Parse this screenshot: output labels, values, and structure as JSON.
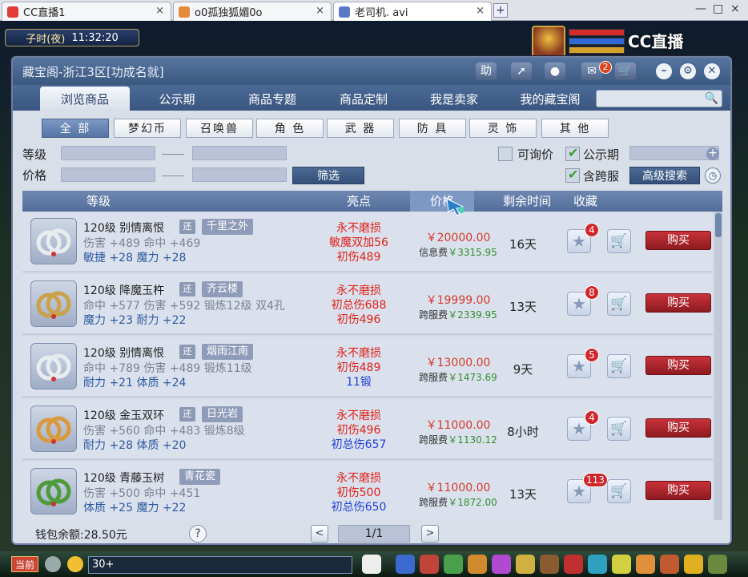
{
  "browser_tabs": [
    {
      "label": "CC直播1",
      "close": "×"
    },
    {
      "label": "o0孤独狐媚0o",
      "close": "×"
    },
    {
      "label": "老司机. avi",
      "close": "×"
    }
  ],
  "new_tab": "+",
  "window_controls": {
    "minimize": "—",
    "maximize": "□",
    "close": "×"
  },
  "game": {
    "clock_period": "子时(夜)",
    "clock_time": "11:32:20",
    "stream_logo": "CC直播",
    "bottom_current": "当前",
    "chat_input": "30+"
  },
  "panel": {
    "title": "藏宝阁-浙江3区[功成名就]",
    "help_label": "助",
    "message_count": "2",
    "nav_tabs": [
      "浏览商品",
      "公示期",
      "商品专题",
      "商品定制",
      "我是卖家",
      "我的藏宝阁"
    ],
    "categories": [
      "全 部",
      "梦幻币",
      "召唤兽",
      "角 色",
      "武 器",
      "防 具",
      "灵 饰",
      "其 他"
    ],
    "filter": {
      "level_label": "等级",
      "price_label": "价格",
      "filter_button": "筛选",
      "inquiry_label": "可询价",
      "public_label": "公示期",
      "cross_label": "含跨服",
      "advanced_button": "高级搜索"
    },
    "columns": {
      "level": "等级",
      "highlight": "亮点",
      "price": "价格",
      "remain": "剩余时间",
      "fav": "收藏"
    },
    "buy_label": "购买",
    "footer": {
      "wallet": "钱包余额:28.50元",
      "help": "?",
      "prev": "<",
      "page": "1/1",
      "next": ">"
    }
  },
  "items": [
    {
      "level_name": "120级  别情离恨",
      "badge": "还",
      "server": "千里之外",
      "stat1": "伤害 +489  命中 +469",
      "stat2": "敏捷 +28  魔力 +28",
      "highlights": [
        "永不磨损",
        "敏魔双加56",
        "初伤489"
      ],
      "highlight_colors": [
        "#e0201a",
        "#e0201a",
        "#e0201a"
      ],
      "price": "￥20000.00",
      "fee_label": "信息费",
      "fee_value": "￥3315.95",
      "time": "16天",
      "fav_count": "4",
      "icon_color": "#e8ecef"
    },
    {
      "level_name": "120级  降魔玉杵",
      "badge": "还",
      "server": "齐云楼",
      "stat1": "命中 +577  伤害 +592  锻炼12级 双4孔",
      "stat2": "魔力 +23  耐力 +22",
      "highlights": [
        "永不磨损",
        "初总伤688",
        "初伤496"
      ],
      "highlight_colors": [
        "#e0201a",
        "#e0201a",
        "#e0201a"
      ],
      "price": "￥19999.00",
      "fee_label": "跨服费",
      "fee_value": "￥2339.95",
      "time": "13天",
      "fav_count": "8",
      "icon_color": "#c9a24a"
    },
    {
      "level_name": "120级  别情离恨",
      "badge": "还",
      "server": "烟雨江南",
      "stat1": "命中 +789  伤害 +489  锻炼11级",
      "stat2": "耐力 +21  体质 +24",
      "highlights": [
        "永不磨损",
        "初伤489",
        "11锻"
      ],
      "highlight_colors": [
        "#e0201a",
        "#e0201a",
        "#1c3fd6"
      ],
      "price": "￥13000.00",
      "fee_label": "跨服费",
      "fee_value": "￥1473.69",
      "time": "9天",
      "fav_count": "5",
      "icon_color": "#e8ecef"
    },
    {
      "level_name": "120级  金玉双环",
      "badge": "还",
      "server": "日光岩",
      "stat1": "伤害 +560  命中 +483  锻炼8级",
      "stat2": "耐力 +28  体质 +20",
      "highlights": [
        "永不磨损",
        "初伤496",
        "初总伤657"
      ],
      "highlight_colors": [
        "#e0201a",
        "#e0201a",
        "#1c3fd6"
      ],
      "price": "￥11000.00",
      "fee_label": "跨服费",
      "fee_value": "￥1130.12",
      "time": "8小时",
      "fav_count": "4",
      "icon_color": "#d89a3c"
    },
    {
      "level_name": "120级  青藤玉树",
      "badge": "",
      "server": "青花瓷",
      "stat1": "伤害 +500  命中 +451",
      "stat2": "体质 +25  魔力 +22",
      "highlights": [
        "永不磨损",
        "初伤500",
        "初总伤650"
      ],
      "highlight_colors": [
        "#e0201a",
        "#e0201a",
        "#1c3fd6"
      ],
      "price": "￥11000.00",
      "fee_label": "跨服费",
      "fee_value": "￥1872.00",
      "time": "13天",
      "fav_count": "113",
      "icon_color": "#4f9a3a"
    }
  ],
  "colors": {
    "accent": "#3b587f",
    "buy": "#b02a30",
    "price": "#d43a2a",
    "fee": "#2f8f2f"
  }
}
